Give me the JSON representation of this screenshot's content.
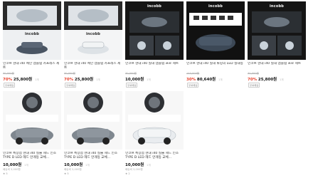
{
  "cards": [
    {
      "brand": "incobb",
      "title": "인코브 현대 i40 메인 엠블럼 카프레스 세트",
      "orig": "30,000원",
      "discount": "70%",
      "price": "25,800원",
      "unit": "1개",
      "badge": "무료배송",
      "ship": "",
      "review": ""
    },
    {
      "brand": "incobb",
      "title": "인코브 현대 i40 메인 엠블럼 카프레스 세트",
      "orig": "30,000원",
      "discount": "70%",
      "price": "25,800원",
      "unit": "1개",
      "badge": "무료배송",
      "ship": "",
      "review": ""
    },
    {
      "brand": "incobb",
      "title": "인코브 현대 i40 실내 엠블럼 프로 세트",
      "orig": "30,000원",
      "discount": "",
      "price": "10,000원",
      "unit": "1개",
      "badge": "무료배송",
      "ship": "",
      "review": ""
    },
    {
      "brand": "incobb",
      "title": "인코브 현대 i40 실내 튜닝의 LED 실내등",
      "orig": "140,000원",
      "discount": "30%",
      "price": "80,640원",
      "unit": "1개",
      "badge": "무료배송",
      "ship": "",
      "review": ""
    },
    {
      "brand": "incobb",
      "title": "인코브 현대 i40 실내 엠블럼 프로 세트",
      "orig": "30,000원",
      "discount": "70%",
      "price": "25,800원",
      "unit": "1개",
      "badge": "무료배송",
      "ship": "",
      "review": ""
    },
    {
      "brand": "incobb",
      "title": "인코브 특장점 현대 i40 실물 헤드 인조 TYPE D LED 헤드 안개등 교체...",
      "orig": "",
      "discount": "",
      "price": "10,000원",
      "unit": "1개",
      "badge": "",
      "ship": "배송비 3,000원",
      "review": "★ 5"
    },
    {
      "brand": "incobb",
      "title": "인코브 특장점 현대 i40 실물 헤드 인조 TYPE D LED 헤드 안개등 교체...",
      "orig": "",
      "discount": "",
      "price": "10,000원",
      "unit": "1개",
      "badge": "",
      "ship": "배송비 3,000원",
      "review": "★ 5"
    },
    {
      "brand": "incobb",
      "title": "인코브 특장점 현대 i40 실물 헤드 인조 TYPE D LED 헤드 안개등 교체...",
      "orig": "",
      "discount": "",
      "price": "10,000원",
      "unit": "1개",
      "badge": "",
      "ship": "배송비 3,000원",
      "review": "★ 2"
    }
  ]
}
